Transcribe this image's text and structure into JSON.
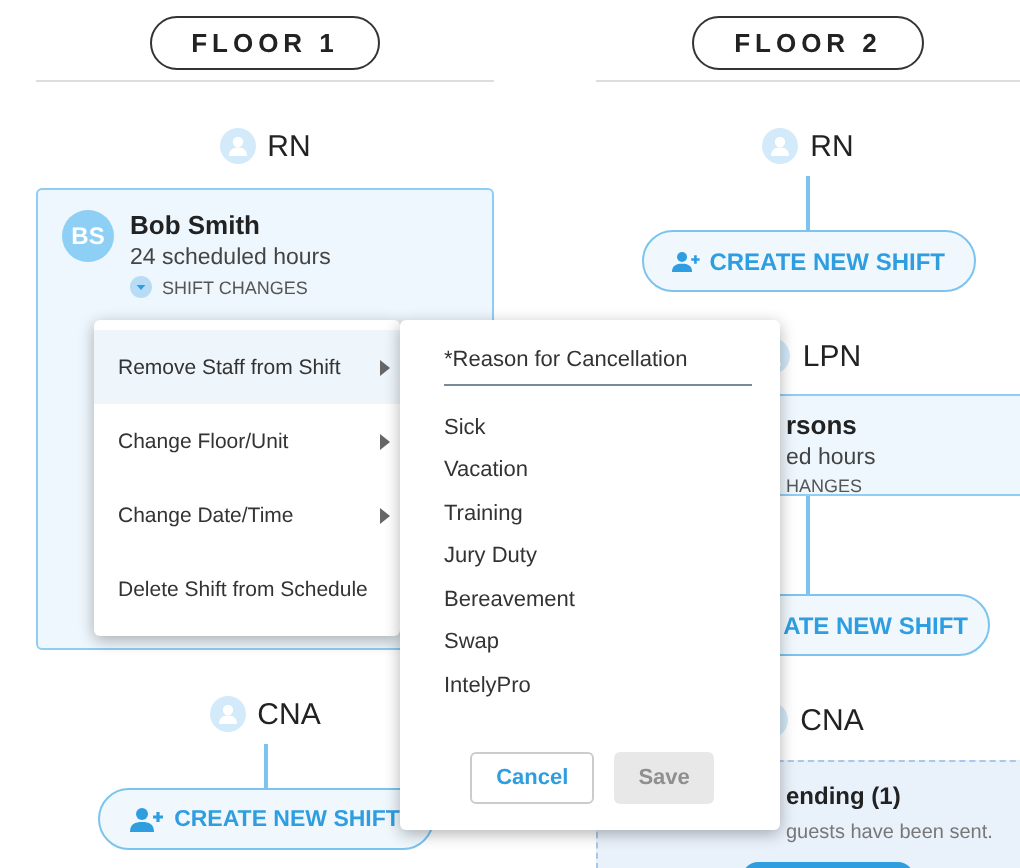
{
  "floors": [
    {
      "title": "FLOOR 1",
      "roles": [
        {
          "name": "RN",
          "cut_off": false,
          "staff": {
            "initials": "BS",
            "name": "Bob Smith",
            "hours": "24 scheduled hours",
            "changes": "SHIFT CHANGES"
          }
        },
        {
          "name": "CNA",
          "cut_off": false,
          "create_button": "CREATE NEW SHIFT"
        }
      ]
    },
    {
      "title": "FLOOR 2",
      "roles": [
        {
          "name": "RN",
          "cut_off": false,
          "create_button": "CREATE NEW SHIFT"
        },
        {
          "name": "LPN",
          "cut_off": true,
          "staff": {
            "name": "rsons",
            "hours": "ed hours",
            "changes": "HANGES"
          },
          "create_button": "ATE NEW SHIFT"
        },
        {
          "name": "CNA",
          "cut_off": true,
          "pending": {
            "title": "ending (1)",
            "text": "guests have been sent."
          }
        }
      ]
    }
  ],
  "context_menu": {
    "items": [
      {
        "label": "Remove Staff from Shift",
        "submenu": true,
        "selected": true
      },
      {
        "label": "Change Floor/Unit",
        "submenu": true,
        "selected": false
      },
      {
        "label": "Change Date/Time",
        "submenu": true,
        "selected": false
      },
      {
        "label": "Delete Shift from Schedule",
        "submenu": false,
        "selected": false
      }
    ]
  },
  "reason_panel": {
    "label": "*Reason for Cancellation",
    "options": [
      "Sick",
      "Vacation",
      "Training",
      "Jury Duty",
      "Bereavement",
      "Swap",
      "IntelyPro"
    ],
    "buttons": [
      {
        "label": "Cancel",
        "disabled": false
      },
      {
        "label": "Save",
        "disabled": true
      }
    ]
  }
}
